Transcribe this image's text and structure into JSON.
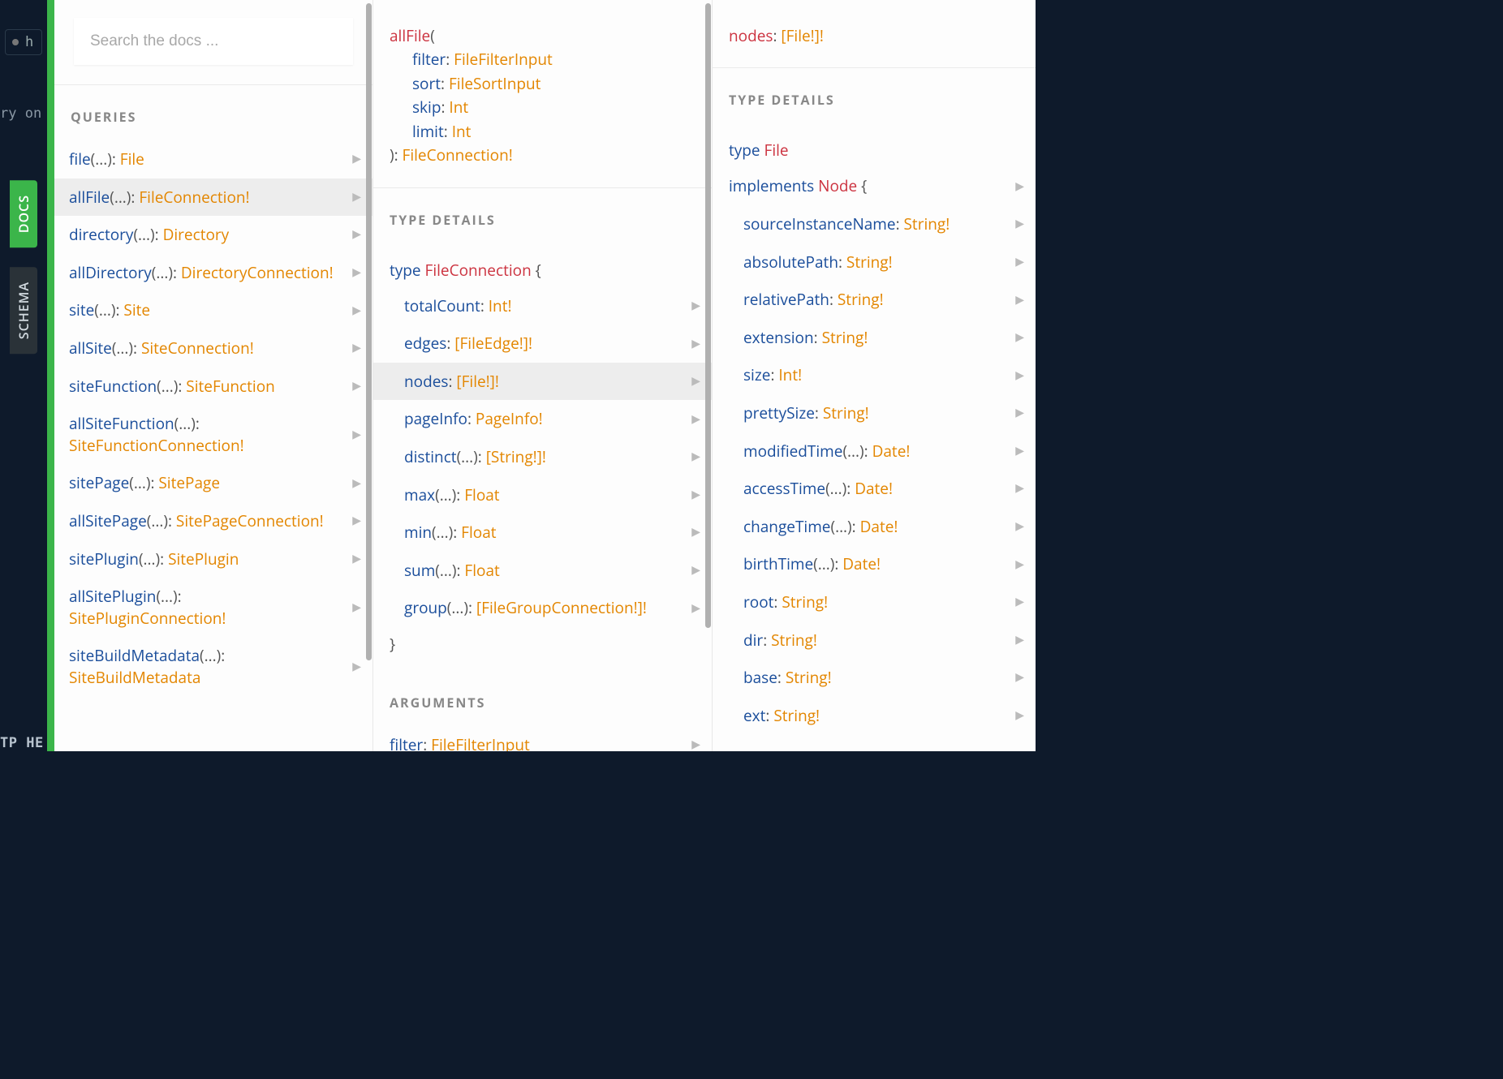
{
  "editor": {
    "tab_prefix": "h",
    "bg_line": "ry on",
    "footer": "TP HE"
  },
  "side_tabs": {
    "docs": "DOCS",
    "schema": "SCHEMA"
  },
  "search": {
    "placeholder": "Search the docs ..."
  },
  "col1": {
    "header": "QUERIES",
    "items": [
      {
        "field": "file",
        "args": "(...)",
        "type": "File"
      },
      {
        "field": "allFile",
        "args": "(...)",
        "type": "FileConnection!",
        "selected": true
      },
      {
        "field": "directory",
        "args": "(...)",
        "type": "Directory"
      },
      {
        "field": "allDirectory",
        "args": "(...)",
        "type": "DirectoryConnection!"
      },
      {
        "field": "site",
        "args": "(...)",
        "type": "Site"
      },
      {
        "field": "allSite",
        "args": "(...)",
        "type": "SiteConnection!"
      },
      {
        "field": "siteFunction",
        "args": "(...)",
        "type": "SiteFunction"
      },
      {
        "field": "allSiteFunction",
        "args": "(...)",
        "type": "SiteFunctionConnection!"
      },
      {
        "field": "sitePage",
        "args": "(...)",
        "type": "SitePage"
      },
      {
        "field": "allSitePage",
        "args": "(...)",
        "type": "SitePageConnection!"
      },
      {
        "field": "sitePlugin",
        "args": "(...)",
        "type": "SitePlugin"
      },
      {
        "field": "allSitePlugin",
        "args": "(...)",
        "type": "SitePluginConnection!"
      },
      {
        "field": "siteBuildMetadata",
        "args": "(...)",
        "type": "SiteBuildMetadata"
      }
    ]
  },
  "col2": {
    "signature": {
      "name": "allFile",
      "args": [
        {
          "name": "filter",
          "type": "FileFilterInput"
        },
        {
          "name": "sort",
          "type": "FileSortInput"
        },
        {
          "name": "skip",
          "type": "Int"
        },
        {
          "name": "limit",
          "type": "Int"
        }
      ],
      "return": "FileConnection!"
    },
    "details_header": "TYPE DETAILS",
    "type_kw": "type",
    "type_name": "FileConnection",
    "brace_open": "{",
    "brace_close": "}",
    "fields": [
      {
        "field": "totalCount",
        "args": "",
        "type": "Int!"
      },
      {
        "field": "edges",
        "args": "",
        "type": "[FileEdge!]!"
      },
      {
        "field": "nodes",
        "args": "",
        "type": "[File!]!",
        "selected": true
      },
      {
        "field": "pageInfo",
        "args": "",
        "type": "PageInfo!"
      },
      {
        "field": "distinct",
        "args": "(...)",
        "type": "[String!]!"
      },
      {
        "field": "max",
        "args": "(...)",
        "type": "Float"
      },
      {
        "field": "min",
        "args": "(...)",
        "type": "Float"
      },
      {
        "field": "sum",
        "args": "(...)",
        "type": "Float"
      },
      {
        "field": "group",
        "args": "(...)",
        "type": "[FileGroupConnection!]!"
      }
    ],
    "args_header": "ARGUMENTS",
    "arg_preview": {
      "name": "filter",
      "type": "FileFilterInput"
    }
  },
  "col3": {
    "signature": {
      "name": "nodes",
      "type": "[File!]!"
    },
    "details_header": "TYPE DETAILS",
    "type_kw": "type",
    "type_name": "File",
    "implements_kw": "implements",
    "implements_name": "Node",
    "brace_open": "{",
    "fields": [
      {
        "field": "sourceInstanceName",
        "args": "",
        "type": "String!"
      },
      {
        "field": "absolutePath",
        "args": "",
        "type": "String!"
      },
      {
        "field": "relativePath",
        "args": "",
        "type": "String!"
      },
      {
        "field": "extension",
        "args": "",
        "type": "String!"
      },
      {
        "field": "size",
        "args": "",
        "type": "Int!"
      },
      {
        "field": "prettySize",
        "args": "",
        "type": "String!"
      },
      {
        "field": "modifiedTime",
        "args": "(...)",
        "type": "Date!"
      },
      {
        "field": "accessTime",
        "args": "(...)",
        "type": "Date!"
      },
      {
        "field": "changeTime",
        "args": "(...)",
        "type": "Date!"
      },
      {
        "field": "birthTime",
        "args": "(...)",
        "type": "Date!"
      },
      {
        "field": "root",
        "args": "",
        "type": "String!"
      },
      {
        "field": "dir",
        "args": "",
        "type": "String!"
      },
      {
        "field": "base",
        "args": "",
        "type": "String!"
      },
      {
        "field": "ext",
        "args": "",
        "type": "String!"
      }
    ]
  }
}
